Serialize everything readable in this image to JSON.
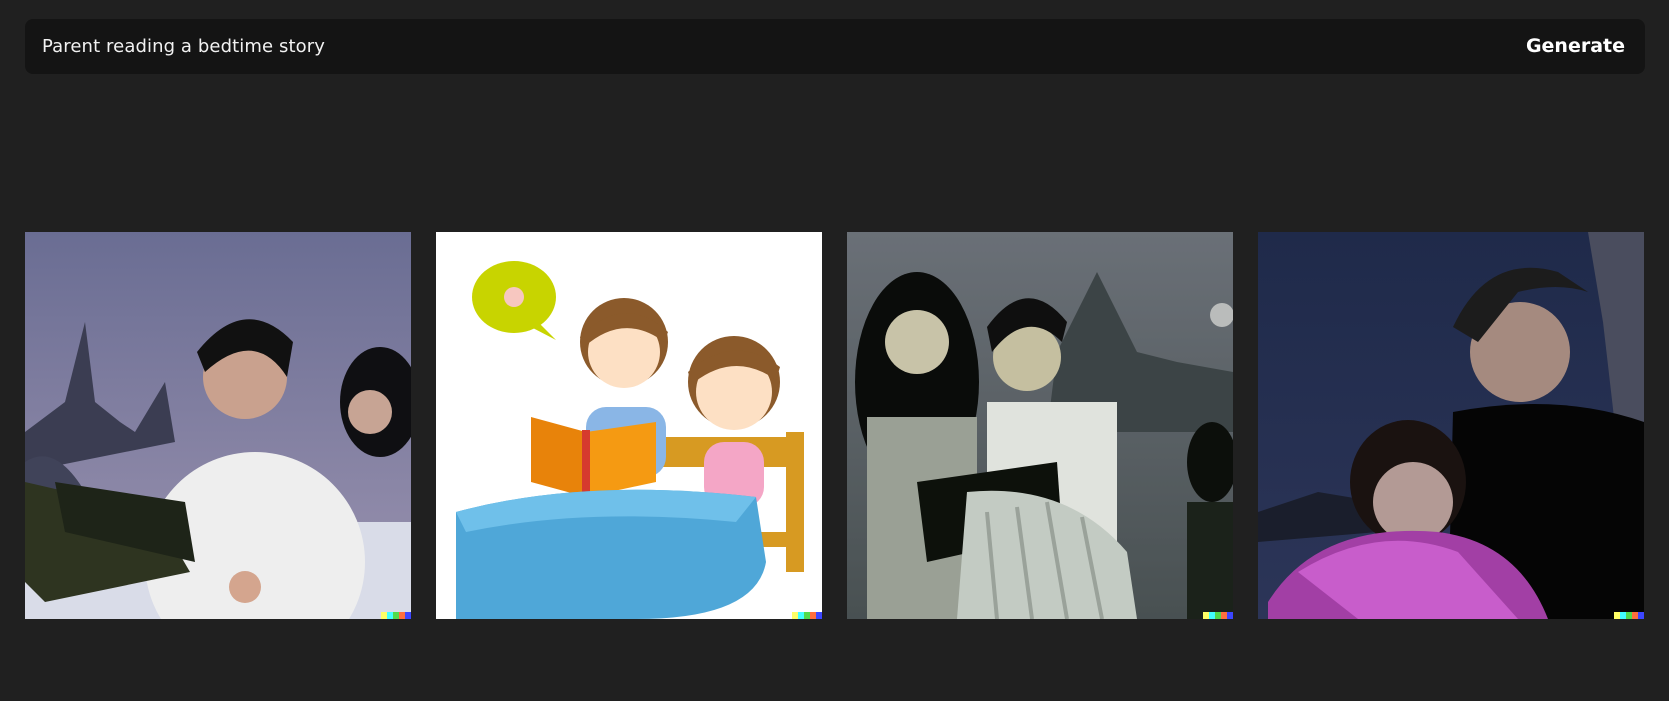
{
  "prompt": {
    "value": "Parent reading a bedtime story",
    "generate_label": "Generate"
  },
  "results": [
    {
      "name": "image-1",
      "alt": "photo-realistic parent reading to child in bed"
    },
    {
      "name": "image-2",
      "alt": "illustration parent and child reading in bed"
    },
    {
      "name": "image-3",
      "alt": "photo couple reading a book in bed at night"
    },
    {
      "name": "image-4",
      "alt": "photo father and daughter under purple blanket"
    }
  ],
  "colors": {
    "background": "#202020",
    "prompt_bar": "#141414",
    "watermark": [
      "#ffff66",
      "#42ffff",
      "#51da4c",
      "#ff6e3c",
      "#3c46ff"
    ]
  }
}
